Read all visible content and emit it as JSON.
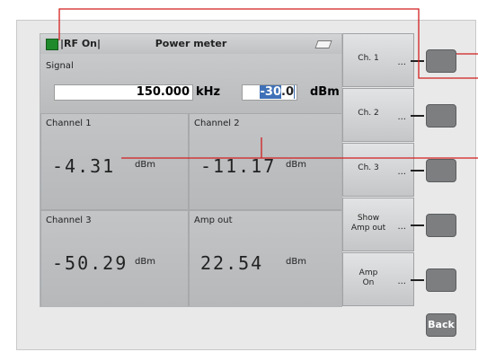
{
  "titlebar": {
    "rf_status": "|RF On|",
    "title": "Power meter"
  },
  "signal": {
    "label": "Signal",
    "frequency": "150.000",
    "frequency_unit": "kHz",
    "level_prefix": "-30",
    "level_selected": ".0",
    "level_unit": "dBm"
  },
  "channels": [
    {
      "label": "Channel 1",
      "value": "-4.31",
      "unit": "dBm"
    },
    {
      "label": "Channel 2",
      "value": "-11.17",
      "unit": "dBm"
    },
    {
      "label": "Channel 3",
      "value": "-50.29",
      "unit": "dBm"
    },
    {
      "label": "Amp out",
      "value": "22.54",
      "unit": "dBm"
    }
  ],
  "softkeys": [
    {
      "label": "Ch. 1",
      "dots": "..."
    },
    {
      "label": "Ch. 2",
      "dots": "..."
    },
    {
      "label": "Ch. 3",
      "dots": "..."
    },
    {
      "label": "Show\nAmp out",
      "dots": "..."
    },
    {
      "label": "Amp\nOn",
      "dots": "..."
    }
  ],
  "back_label": "Back",
  "colors": {
    "rf_led": "#1f8a2b",
    "selection": "#3f71b7",
    "callout_line": "#d21f1f"
  }
}
